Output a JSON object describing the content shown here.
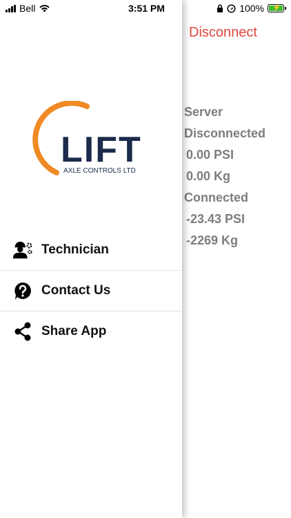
{
  "status_bar": {
    "carrier": "Bell",
    "time": "3:51 PM",
    "battery": "100%"
  },
  "main": {
    "disconnect_label": "Disconnect",
    "readouts": [
      "Server",
      "Disconnected",
      "0.00 PSI",
      "0.00 Kg",
      "Connected",
      "-23.43 PSI",
      "-2269 Kg"
    ]
  },
  "drawer": {
    "logo": {
      "wordmark": "LIFT",
      "tagline": "AXLE CONTROLS LTD",
      "colors": {
        "ring": "#f08a24",
        "text": "#1b2b4b"
      }
    },
    "menu": [
      {
        "label": "Technician",
        "icon": "technician-icon"
      },
      {
        "label": "Contact Us",
        "icon": "help-circle-icon"
      },
      {
        "label": "Share App",
        "icon": "share-icon"
      }
    ]
  },
  "colors": {
    "disconnect": "#e0463e",
    "readout": "#7d7d7d",
    "battery": "#3dbb2f"
  }
}
